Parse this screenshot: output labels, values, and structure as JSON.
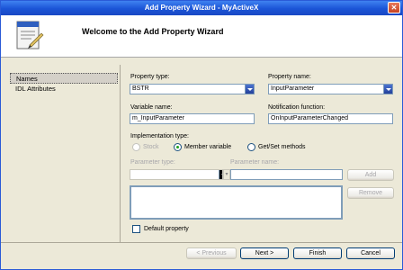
{
  "window": {
    "title": "Add Property Wizard - MyActiveX",
    "close_glyph": "✕"
  },
  "header": {
    "heading": "Welcome to the Add Property Wizard",
    "icon": "wizard-document-icon"
  },
  "nav": {
    "items": [
      {
        "label": "Names",
        "selected": true
      },
      {
        "label": "IDL Attributes",
        "selected": false
      }
    ]
  },
  "form": {
    "property_type": {
      "label": "Property type:",
      "value": "BSTR"
    },
    "property_name": {
      "label": "Property name:",
      "value": "InputParameter"
    },
    "variable_name": {
      "label": "Variable name:",
      "value": "m_InputParameter"
    },
    "notification_function": {
      "label": "Notification function:",
      "value": "OnInputParameterChanged"
    },
    "implementation_type": {
      "label": "Implementation type:",
      "options": [
        {
          "label": "Stock",
          "selected": false,
          "enabled": false
        },
        {
          "label": "Member variable",
          "selected": true,
          "enabled": true
        },
        {
          "label": "Get/Set methods",
          "selected": false,
          "enabled": true
        }
      ]
    },
    "parameter_type": {
      "label": "Parameter type:",
      "value": ""
    },
    "parameter_name": {
      "label": "Parameter name:",
      "value": ""
    },
    "add_label": "Add",
    "remove_label": "Remove",
    "default_property": {
      "label": "Default property",
      "checked": false
    }
  },
  "footer": {
    "previous": "< Previous",
    "next": "Next >",
    "finish": "Finish",
    "cancel": "Cancel"
  }
}
